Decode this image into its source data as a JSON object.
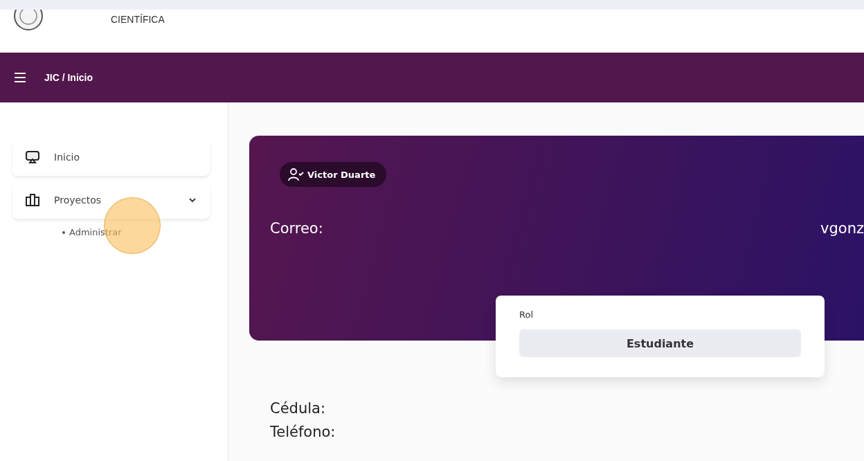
{
  "header": {
    "brand_subtitle": "CIENTÍFICA"
  },
  "navbar": {
    "breadcrumb": "JIC / Inicio"
  },
  "sidebar": {
    "items": [
      {
        "label": "Inicio",
        "kind": "screen"
      },
      {
        "label": "Proyectos",
        "kind": "columns",
        "expanded": true,
        "children": [
          {
            "label": "Administrar"
          }
        ]
      }
    ]
  },
  "profile": {
    "user_chip": "Victor Duarte",
    "email_label": "Correo:",
    "email_value": "vgonz",
    "role_popup": {
      "label": "Rol",
      "value": "Estudiante"
    },
    "fields": [
      "Cédula:",
      "Teléfono:"
    ]
  }
}
